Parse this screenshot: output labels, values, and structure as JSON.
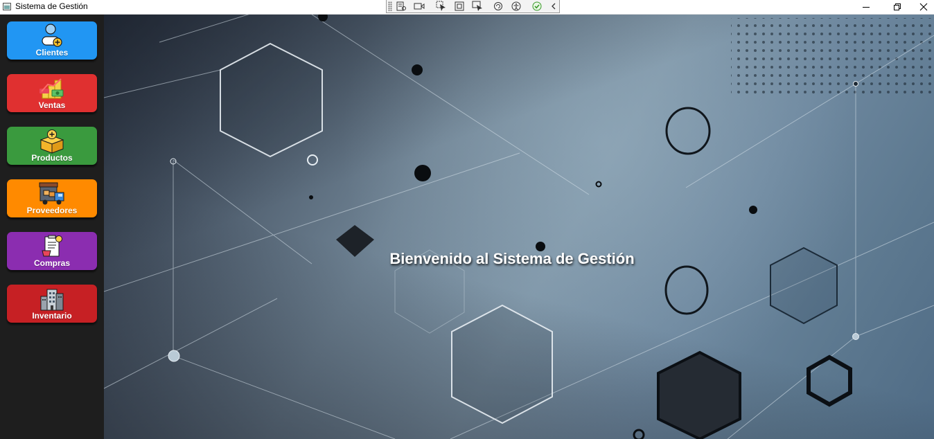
{
  "window": {
    "title": "Sistema de Gestión",
    "controls": [
      "minimize-icon",
      "restore-icon",
      "close-icon"
    ]
  },
  "debug_toolbar": {
    "icons": [
      "live-visual-tree-icon",
      "record-icon",
      "select-element-icon",
      "display-layout-adorners-icon",
      "track-focus-icon",
      "hot-reload-icon",
      "accessibility-icon",
      "binding-check-icon",
      "collapse-chevron-icon"
    ]
  },
  "sidebar": {
    "items": [
      {
        "label": "Clientes",
        "icon": "add-user-icon",
        "color": "#2196f3"
      },
      {
        "label": "Ventas",
        "icon": "money-stack-icon",
        "color": "#e03030"
      },
      {
        "label": "Productos",
        "icon": "add-box-icon",
        "color": "#3a9a3e"
      },
      {
        "label": "Proveedores",
        "icon": "delivery-truck-icon",
        "color": "#ff8a00"
      },
      {
        "label": "Compras",
        "icon": "invoice-basket-icon",
        "color": "#8b2db0"
      },
      {
        "label": "Inventario",
        "icon": "warehouse-building-icon",
        "color": "#c62024"
      }
    ]
  },
  "main": {
    "welcome": "Bienvenido al Sistema de Gestión"
  }
}
